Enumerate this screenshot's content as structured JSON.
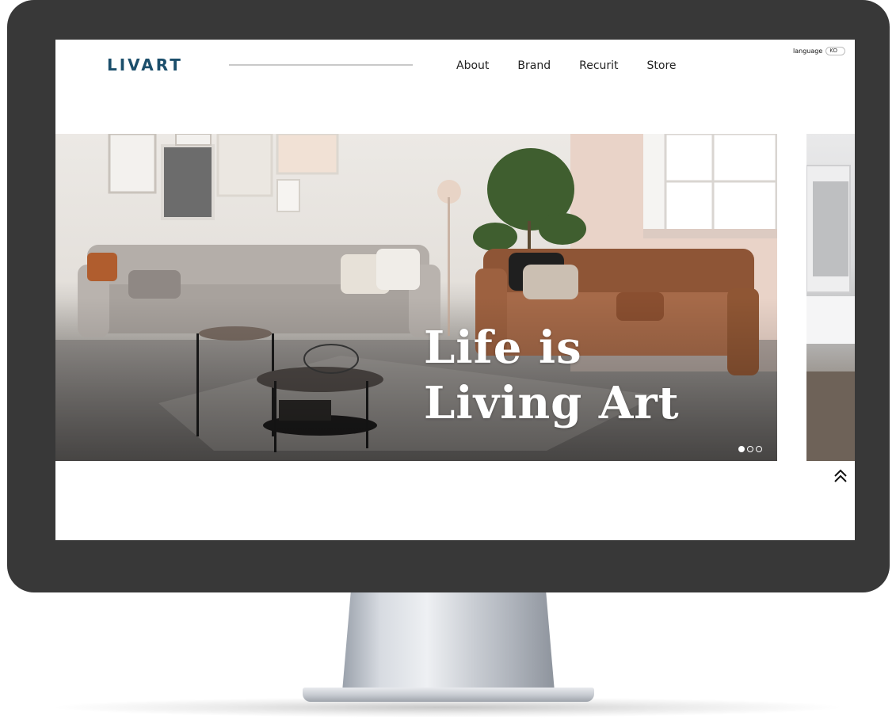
{
  "header": {
    "logo": "LIVART",
    "nav": [
      {
        "label": "About"
      },
      {
        "label": "Brand"
      },
      {
        "label": "Recurit"
      },
      {
        "label": "Store"
      }
    ],
    "language": {
      "label": "language",
      "value": "KO"
    }
  },
  "hero": {
    "title_line1": "Life is",
    "title_line2": "Living Art",
    "slides_total": 3,
    "active_slide": 1
  },
  "icons": {
    "top_button": "double-chevron-up-icon"
  },
  "colors": {
    "brand": "#1b4e6b",
    "frame": "#383838"
  }
}
